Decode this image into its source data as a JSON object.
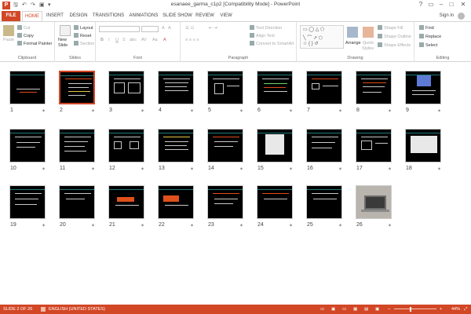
{
  "window": {
    "title": "esanaee_garma_c1p2 [Compatibility Mode] - PowerPoint",
    "minimize": "–",
    "maximize": "□",
    "close": "✕",
    "help": "?",
    "restore": "▭"
  },
  "qat": {
    "save": "🖫",
    "undo": "↶",
    "redo": "↷",
    "slideshow": "▣",
    "customize": "▾"
  },
  "tabs": [
    "FILE",
    "HOME",
    "INSERT",
    "DESIGN",
    "TRANSITIONS",
    "ANIMATIONS",
    "SLIDE SHOW",
    "REVIEW",
    "VIEW"
  ],
  "active_tab": "HOME",
  "signin": "Sign in",
  "ribbon": {
    "clipboard": {
      "label": "Clipboard",
      "paste": "Paste",
      "cut": "Cut",
      "copy": "Copy",
      "format_painter": "Format Painter"
    },
    "slides": {
      "label": "Slides",
      "new_slide": "New",
      "new_slide2": "Slide",
      "layout": "Layout",
      "reset": "Reset",
      "section": "Section"
    },
    "font": {
      "label": "Font",
      "bold": "B",
      "italic": "I",
      "underline": "U",
      "strike": "S",
      "shadow": "abc",
      "spacing": "AV",
      "case": "Aa",
      "color": "A"
    },
    "paragraph": {
      "label": "Paragraph",
      "text_direction": "Text Direction",
      "align_text": "Align Text",
      "smartart": "Convert to SmartArt"
    },
    "drawing": {
      "label": "Drawing",
      "arrange": "Arrange",
      "quick_styles": "Quick",
      "quick_styles2": "Styles",
      "shape_fill": "Shape Fill",
      "shape_outline": "Shape Outline",
      "shape_effects": "Shape Effects"
    },
    "editing": {
      "label": "Editing",
      "find": "Find",
      "replace": "Replace",
      "select": "Select"
    }
  },
  "slides": [
    {
      "n": "1",
      "star": "✶"
    },
    {
      "n": "2",
      "star": "✶"
    },
    {
      "n": "3",
      "star": "✶"
    },
    {
      "n": "4",
      "star": "✶"
    },
    {
      "n": "5",
      "star": "✶"
    },
    {
      "n": "6",
      "star": "✶"
    },
    {
      "n": "7",
      "star": "✶"
    },
    {
      "n": "8",
      "star": "✶"
    },
    {
      "n": "9",
      "star": "✶"
    },
    {
      "n": "10",
      "star": "✶"
    },
    {
      "n": "11",
      "star": "✶"
    },
    {
      "n": "12",
      "star": "✶"
    },
    {
      "n": "13",
      "star": "✶"
    },
    {
      "n": "14",
      "star": "✶"
    },
    {
      "n": "15",
      "star": "✶"
    },
    {
      "n": "16",
      "star": "✶"
    },
    {
      "n": "17",
      "star": "✶"
    },
    {
      "n": "18",
      "star": "✶"
    },
    {
      "n": "19",
      "star": "✶"
    },
    {
      "n": "20",
      "star": "✶"
    },
    {
      "n": "21",
      "star": "✶"
    },
    {
      "n": "22",
      "star": "✶"
    },
    {
      "n": "23",
      "star": "✶"
    },
    {
      "n": "24",
      "star": "✶"
    },
    {
      "n": "25",
      "star": "✶"
    },
    {
      "n": "26",
      "star": "✶"
    }
  ],
  "selected_slide": "2",
  "status": {
    "slide_info": "SLIDE 2 OF 26",
    "language": "ENGLISH (UNITED STATES)",
    "zoom": "44%",
    "zoom_minus": "–",
    "zoom_plus": "+"
  },
  "colors": {
    "accent": "#d24726",
    "slide_bg": "#000000",
    "slide_band": "#1f7a7a"
  }
}
